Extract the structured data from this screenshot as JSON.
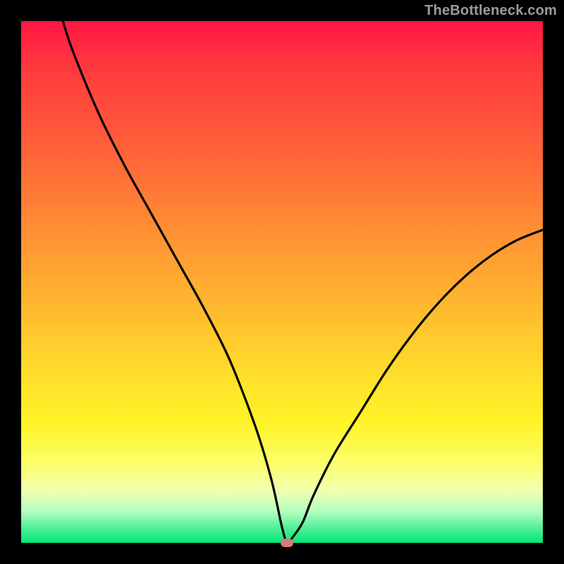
{
  "watermark": "TheBottleneck.com",
  "chart_data": {
    "type": "line",
    "title": "",
    "xlabel": "",
    "ylabel": "",
    "xlim": [
      0,
      100
    ],
    "ylim": [
      0,
      100
    ],
    "grid": false,
    "legend": false,
    "note": "Single V-shaped curve over a vertical red-to-green gradient. Minimum near x≈51 at y≈0. Marker at the minimum.",
    "x": [
      8,
      10,
      15,
      20,
      25,
      30,
      35,
      40,
      45,
      48,
      50,
      51,
      52,
      54,
      56,
      60,
      65,
      70,
      75,
      80,
      85,
      90,
      95,
      100
    ],
    "y": [
      100,
      94,
      82,
      72,
      63,
      54,
      45,
      35,
      22,
      12,
      3,
      0,
      1,
      4,
      9,
      17,
      25,
      33,
      40,
      46,
      51,
      55,
      58,
      60
    ],
    "marker": {
      "x": 51,
      "y": 0
    },
    "gradient_stops": [
      {
        "pos": 0,
        "color": "#ff1744"
      },
      {
        "pos": 10,
        "color": "#ff3d3d"
      },
      {
        "pos": 22,
        "color": "#ff5a3a"
      },
      {
        "pos": 33,
        "color": "#ff7a36"
      },
      {
        "pos": 44,
        "color": "#ff9a33"
      },
      {
        "pos": 55,
        "color": "#ffb92f"
      },
      {
        "pos": 66,
        "color": "#ffd92b"
      },
      {
        "pos": 77,
        "color": "#fff428"
      },
      {
        "pos": 85,
        "color": "#fbff6e"
      },
      {
        "pos": 90,
        "color": "#f1ffb0"
      },
      {
        "pos": 94,
        "color": "#b4ffc0"
      },
      {
        "pos": 97,
        "color": "#55f09a"
      },
      {
        "pos": 100,
        "color": "#00e676"
      }
    ]
  }
}
